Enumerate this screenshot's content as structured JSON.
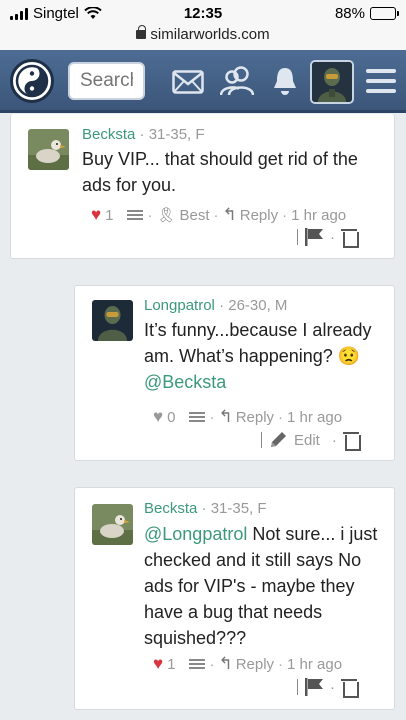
{
  "status_bar": {
    "carrier": "Singtel",
    "time": "12:35",
    "battery": "88%",
    "battery_level": 0.88
  },
  "browser": {
    "url": "similarworlds.com"
  },
  "header": {
    "search_placeholder": "Search"
  },
  "comments": [
    {
      "username": "Becksta",
      "meta": " · 31-35, F",
      "text": "Buy VIP... that should get rid of the ads for you.",
      "likes": "1",
      "best_label": "Best",
      "reply_label": "Reply",
      "time": "1 hr ago"
    },
    {
      "username": "Longpatrol",
      "meta": " · 26-30, M",
      "text_before": "It’s funny...because I already am. What’s happening?",
      "emoji": "😟",
      "mention": "@Becksta",
      "likes": "0",
      "reply_label": "Reply",
      "time": "1 hr ago",
      "edit_label": "Edit"
    },
    {
      "username": "Becksta",
      "meta": " · 31-35, F",
      "mention": "@Longpatrol",
      "text_after": " Not sure... i just checked and it still says No ads for VIP's - maybe they have a bug that needs squished???",
      "likes": "1",
      "reply_label": "Reply",
      "time": "1 hr ago"
    }
  ],
  "colors": {
    "header": "#4e6c94",
    "username": "#3c9a7a",
    "heart": "#d9343e"
  }
}
